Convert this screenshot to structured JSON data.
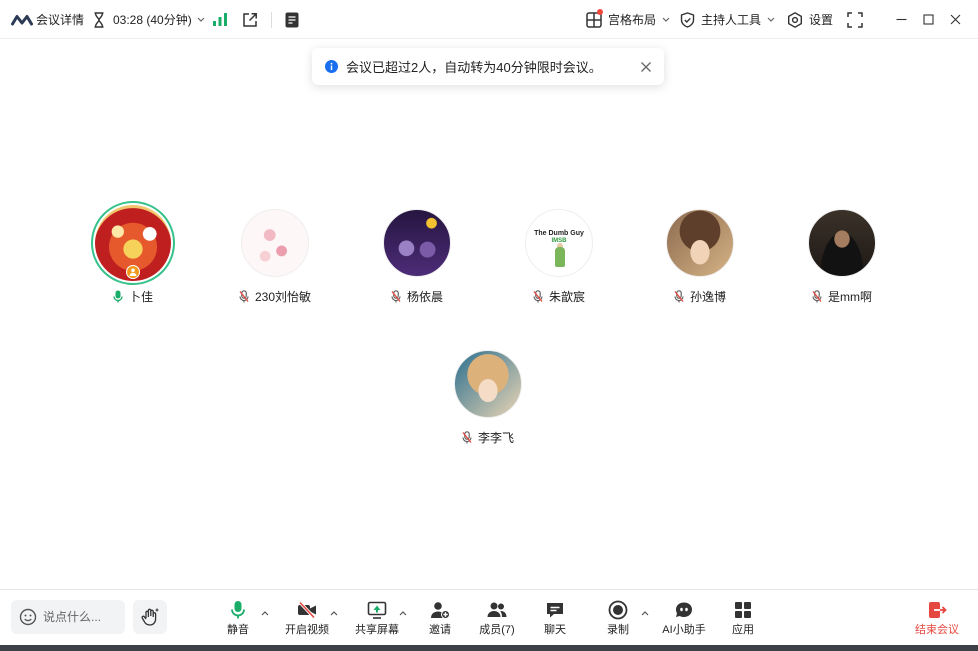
{
  "colors": {
    "accent_green": "#1aad6a",
    "end_red": "#e5483f",
    "info_blue": "#1a6ff0",
    "speaker_ring": "#36c28a"
  },
  "topbar": {
    "meeting_details": "会议详情",
    "timer": "03:28 (40分钟)",
    "layout": "宫格布局",
    "host_tools": "主持人工具",
    "settings": "设置",
    "icons": [
      "meeting-logo-icon",
      "hourglass-icon",
      "signal-icon",
      "external-share-icon",
      "notes-icon",
      "grid-layout-icon",
      "shield-icon",
      "gear-icon",
      "fullscreen-icon",
      "minimize-icon",
      "maximize-icon",
      "close-icon"
    ]
  },
  "toast": {
    "message": "会议已超过2人，自动转为40分钟限时会议。"
  },
  "participants": [
    {
      "name": "卜佳",
      "mic": "mic-on-icon",
      "active_speaker": true,
      "host_badge": true
    },
    {
      "name": "230刘怡敏",
      "mic": "mic-muted-icon"
    },
    {
      "name": "杨依晨",
      "mic": "mic-muted-icon"
    },
    {
      "name": "朱歆宸",
      "mic": "mic-muted-icon",
      "avatar_text": [
        "The Dumb Guy",
        "IMSB"
      ]
    },
    {
      "name": "孙逸博",
      "mic": "mic-muted-icon"
    },
    {
      "name": "是mm啊",
      "mic": "mic-muted-icon"
    },
    {
      "name": "李李飞",
      "mic": "mic-muted-icon"
    }
  ],
  "chat": {
    "placeholder": "说点什么..."
  },
  "toolbar": {
    "mute": "静音",
    "video": "开启视频",
    "share": "共享屏幕",
    "invite": "邀请",
    "members": "成员(7)",
    "chat": "聊天",
    "record": "录制",
    "ai": "AI小助手",
    "apps": "应用",
    "end": "结束会议"
  }
}
